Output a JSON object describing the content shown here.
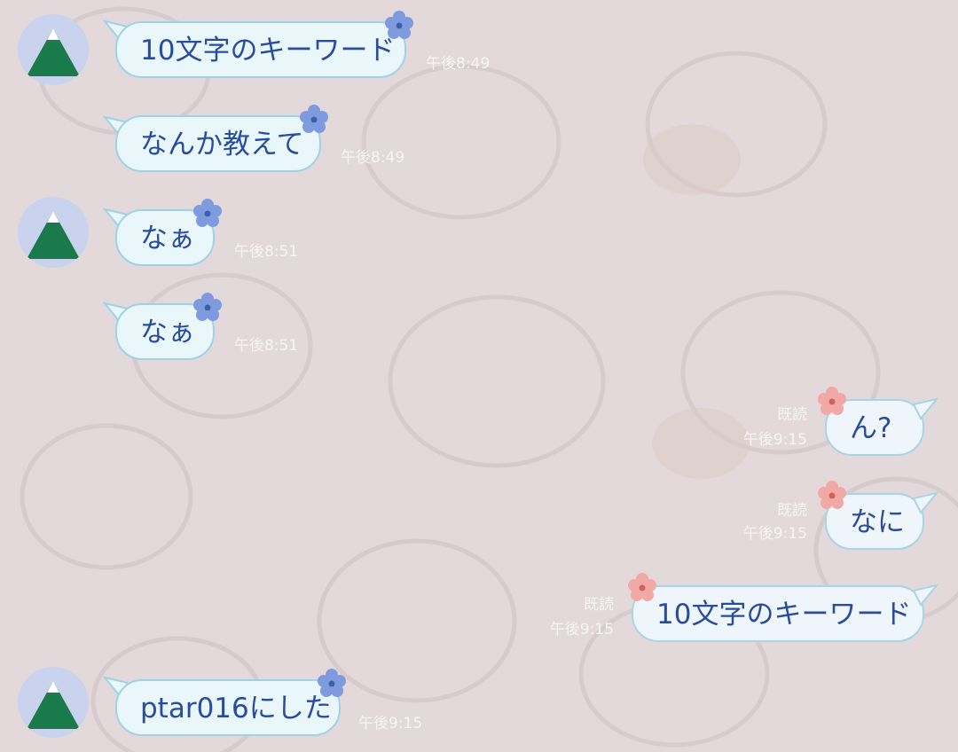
{
  "colors": {
    "background": "#e4d9da",
    "bubble_fill": "#e9f7fb",
    "bubble_border": "#9fd2e6",
    "message_text": "#2a4c9c",
    "meta_text": "#f7f4f5",
    "incoming_flower": "#7f9be0",
    "outgoing_flower": "#f2a9a6"
  },
  "wallpaper_icon": "bear-pattern",
  "avatar_icon": "mountain-icon",
  "messages": [
    {
      "side": "incoming",
      "text": "10文字のキーワード",
      "time": "午後8:49",
      "read": ""
    },
    {
      "side": "incoming",
      "text": "なんか教えて",
      "time": "午後8:49",
      "read": ""
    },
    {
      "side": "incoming",
      "text": "なぁ",
      "time": "午後8:51",
      "read": ""
    },
    {
      "side": "incoming",
      "text": "なぁ",
      "time": "午後8:51",
      "read": ""
    },
    {
      "side": "outgoing",
      "text": "ん?",
      "time": "午後9:15",
      "read": "既読"
    },
    {
      "side": "outgoing",
      "text": "なに",
      "time": "午後9:15",
      "read": "既読"
    },
    {
      "side": "outgoing",
      "text": "10文字のキーワード",
      "time": "午後9:15",
      "read": "既読"
    },
    {
      "side": "incoming",
      "text": "ptar016にした",
      "time": "午後9:15",
      "read": ""
    }
  ]
}
